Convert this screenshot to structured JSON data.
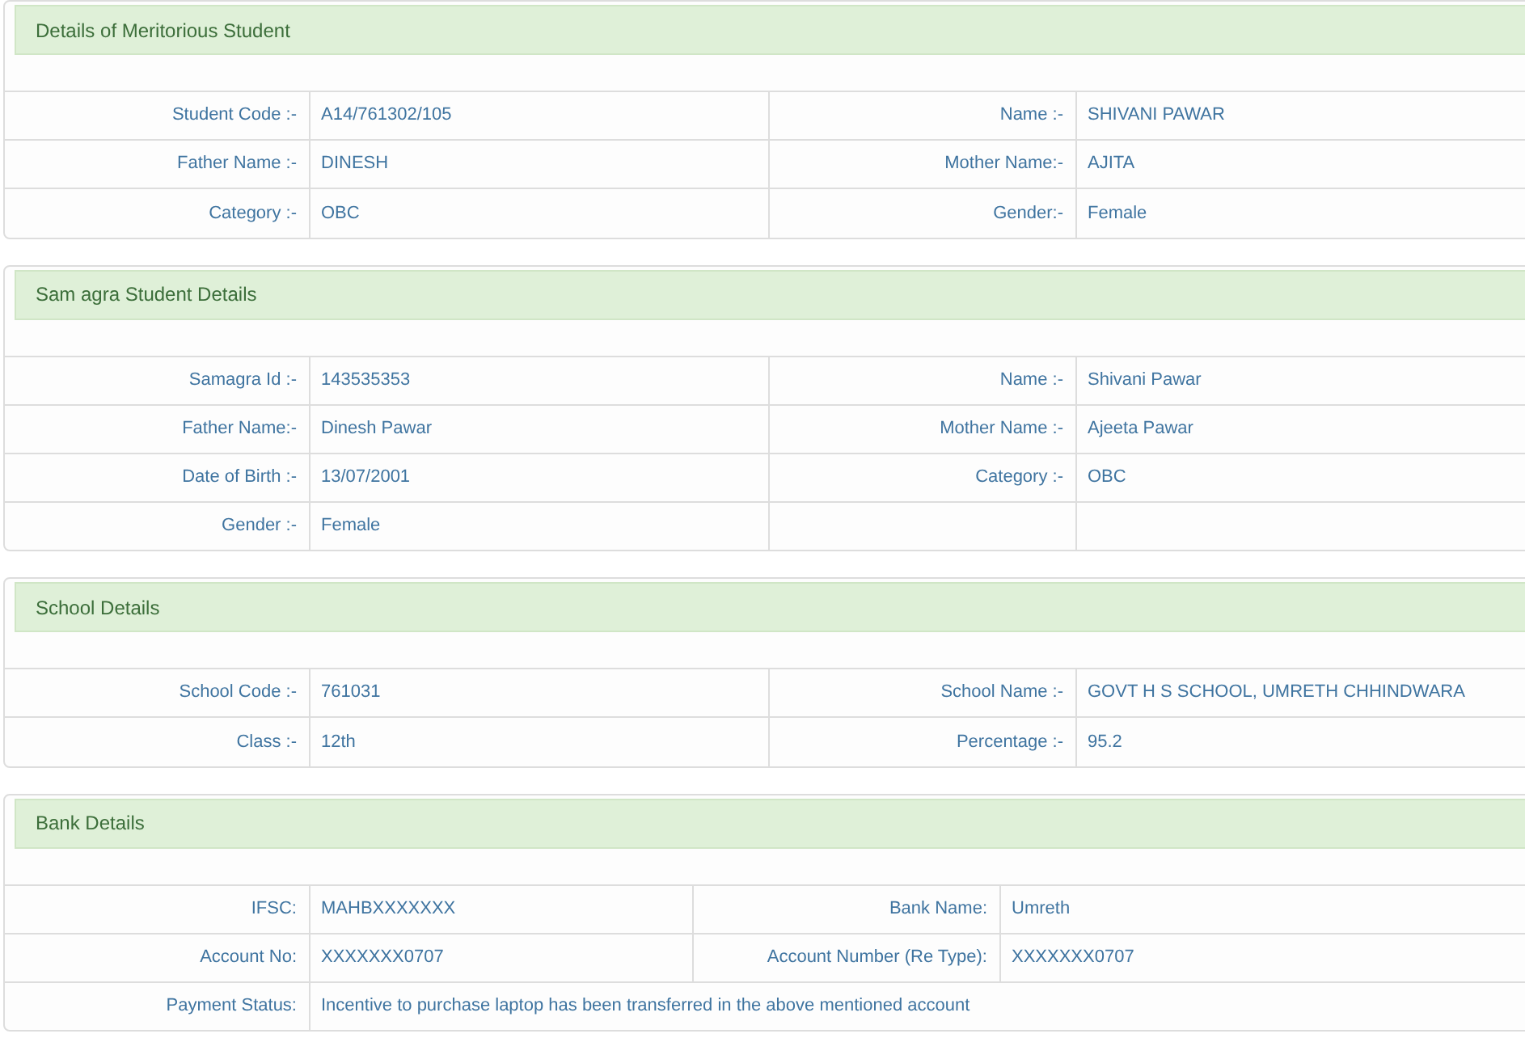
{
  "sections": [
    {
      "title": "Details of Meritorious Student",
      "rows": [
        [
          {
            "label": "Student Code :-",
            "value": "A14/761302/105"
          },
          {
            "label": "Name :-",
            "value": "SHIVANI PAWAR"
          }
        ],
        [
          {
            "label": "Father Name :-",
            "value": "DINESH"
          },
          {
            "label": "Mother Name:-",
            "value": "AJITA"
          }
        ],
        [
          {
            "label": "Category :-",
            "value": "OBC"
          },
          {
            "label": "Gender:-",
            "value": "Female"
          }
        ]
      ]
    },
    {
      "title": "Sam agra Student Details",
      "rows": [
        [
          {
            "label": "Samagra Id :-",
            "value": "143535353"
          },
          {
            "label": "Name :-",
            "value": "Shivani Pawar"
          }
        ],
        [
          {
            "label": "Father Name:-",
            "value": "Dinesh Pawar"
          },
          {
            "label": "Mother Name :-",
            "value": "Ajeeta Pawar"
          }
        ],
        [
          {
            "label": "Date of Birth :-",
            "value": "13/07/2001"
          },
          {
            "label": "Category :-",
            "value": "OBC"
          }
        ],
        [
          {
            "label": "Gender :-",
            "value": "Female"
          }
        ]
      ]
    },
    {
      "title": "School Details",
      "rows": [
        [
          {
            "label": "School Code :-",
            "value": "761031"
          },
          {
            "label": "School Name :-",
            "value": "GOVT H S SCHOOL, UMRETH CHHINDWARA"
          }
        ],
        [
          {
            "label": "Class :-",
            "value": "12th"
          },
          {
            "label": "Percentage :-",
            "value": "95.2"
          }
        ]
      ]
    },
    {
      "title": "Bank Details",
      "rows": [
        [
          {
            "label": "IFSC:",
            "value": "MAHBXXXXXXX"
          },
          {
            "label": "Bank Name:",
            "value": "Umreth"
          }
        ],
        [
          {
            "label": "Account No:",
            "value": "XXXXXXX0707"
          },
          {
            "label": "Account Number (Re Type):",
            "value": "XXXXXXX0707"
          }
        ],
        [
          {
            "label": "Payment Status:",
            "value": "Incentive to purchase laptop has been transferred in the above mentioned account"
          }
        ]
      ]
    }
  ]
}
